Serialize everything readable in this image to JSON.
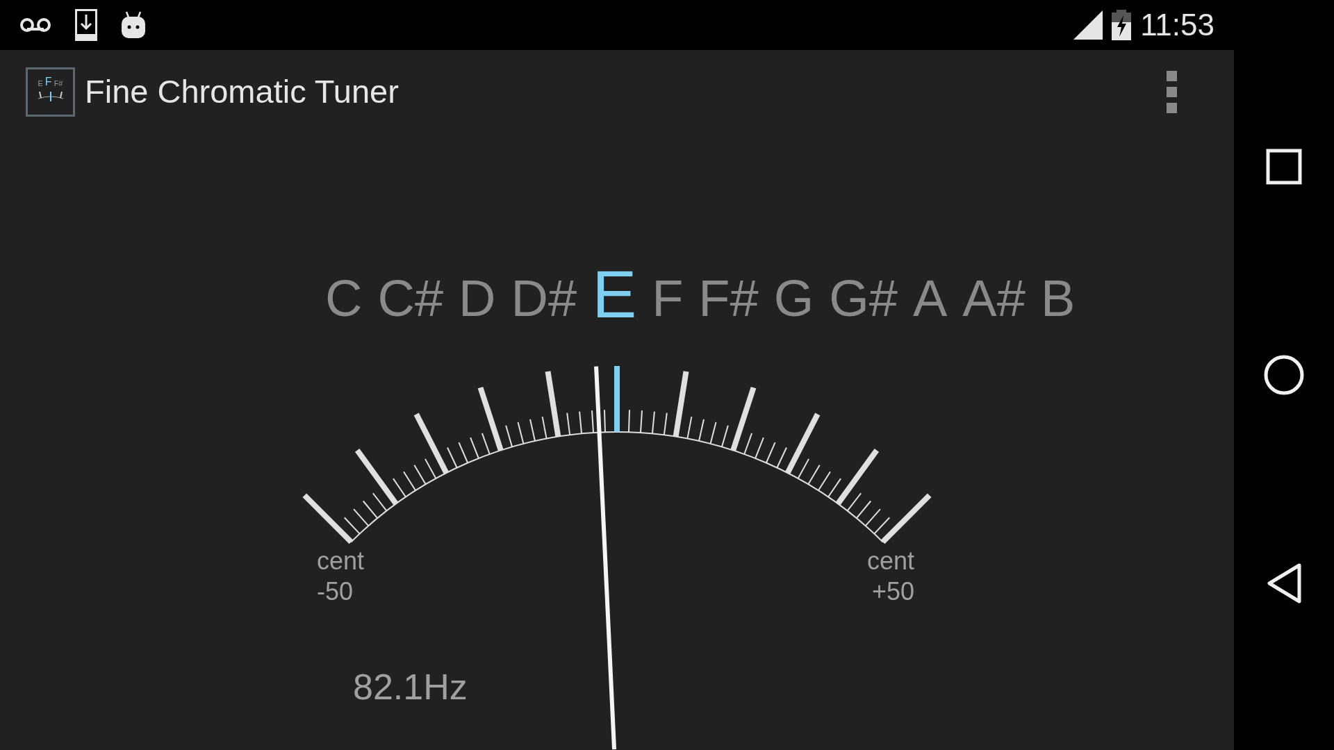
{
  "status_bar": {
    "time": "11:53"
  },
  "app_bar": {
    "title": "Fine Chromatic Tuner",
    "icon_notes": [
      {
        "label": "E",
        "selected": false
      },
      {
        "label": "F",
        "selected": true
      },
      {
        "label": "F#",
        "selected": false
      }
    ]
  },
  "notes": [
    {
      "label": "C",
      "selected": false
    },
    {
      "label": "C#",
      "selected": false
    },
    {
      "label": "D",
      "selected": false
    },
    {
      "label": "D#",
      "selected": false
    },
    {
      "label": "E",
      "selected": true
    },
    {
      "label": "F",
      "selected": false
    },
    {
      "label": "F#",
      "selected": false
    },
    {
      "label": "G",
      "selected": false
    },
    {
      "label": "G#",
      "selected": false
    },
    {
      "label": "A",
      "selected": false
    },
    {
      "label": "A#",
      "selected": false
    },
    {
      "label": "B",
      "selected": false
    }
  ],
  "meter": {
    "level": 0.47,
    "left_label": [
      "cent",
      "-50"
    ],
    "right_label": [
      "cent",
      "+50"
    ]
  },
  "frequency": "82.1Hz"
}
